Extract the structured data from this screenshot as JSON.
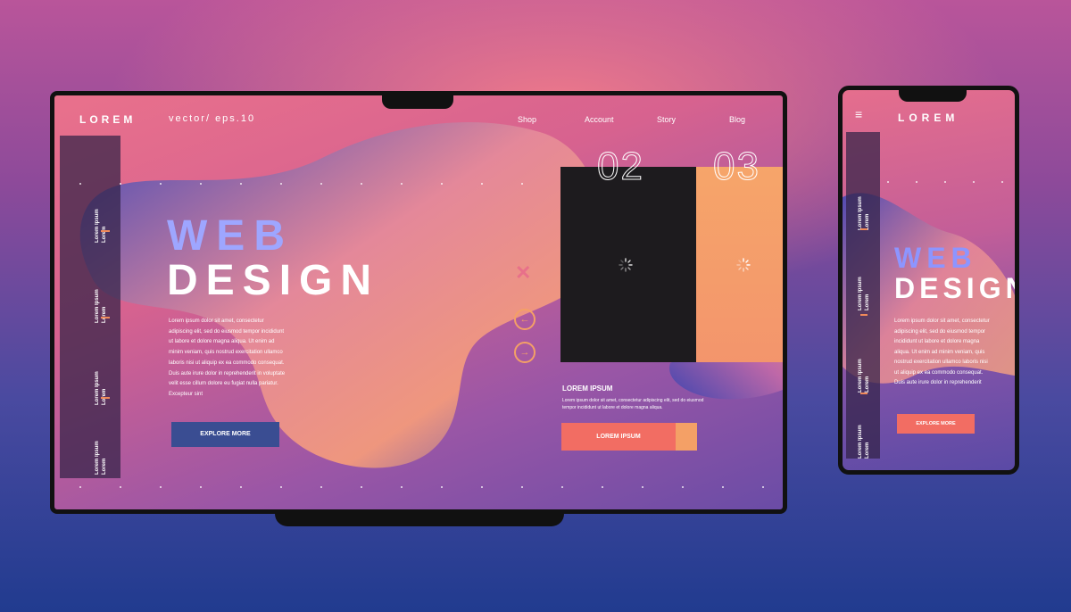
{
  "colors": {
    "accent_coral": "#f26d63",
    "accent_peach": "#f4a066",
    "accent_blue": "#3a4d92",
    "heading_lavender": "#9ea6ff",
    "card_dark": "#1d1b1e"
  },
  "desktop": {
    "nav": {
      "logo": "LOREM",
      "subtitle": "vector/ eps.10",
      "links": [
        "Shop",
        "Account",
        "Story",
        "Blog"
      ]
    },
    "sidebar": {
      "items": [
        "Lorem Ipsum\nLorem",
        "Lorem Ipsum\nLorem",
        "Lorem Ipsum\nLorem",
        "Lorem Ipsum\nLorem"
      ]
    },
    "hero": {
      "line1": "WEB",
      "line2": "DESIGN",
      "body": "Lorem ipsum dolor sit amet, consectetur adipiscing elit, sed do eiusmod tempor incididunt ut labore et dolore magna aliqua. Ut enim ad minim veniam, quis nostrud exercitation ullamco laboris nisi ut aliquip ex ea commodo consequat. Duis aute irure dolor in reprehenderit in voluptate velit esse cillum dolore eu fugiat nulla pariatur. Excepteur sint",
      "button": "EXPLORE MORE"
    },
    "slides": {
      "number_current": "02",
      "number_next": "03",
      "close_icon": "close-icon",
      "prev_icon": "arrow-left-icon",
      "next_icon": "arrow-right-icon",
      "title": "LOREM IPSUM",
      "body": "Lorem ipsum dolor sit amet, consectetur adipiscing elit, sed do eiusmod tempor incididunt ut labore et dolore magna aliqua.",
      "button": "LOREM IPSUM"
    }
  },
  "mobile": {
    "menu_icon": "hamburger-menu-icon",
    "logo": "LOREM",
    "sidebar": {
      "items": [
        "Lorem Ipsum\nLorem",
        "Lorem Ipsum\nLorem",
        "Lorem Ipsum\nLorem",
        "Lorem Ipsum\nLorem"
      ]
    },
    "hero": {
      "line1": "WEB",
      "line2": "DESIGN",
      "body": "Lorem ipsum dolor sit amet, consectetur adipiscing elit, sed do eiusmod tempor incididunt ut labore et dolore magna aliqua. Ut enim ad minim veniam, quis nostrud exercitation ullamco laboris nisi ut aliquip ex ea commodo consequat. Duis aute irure dolor in reprehenderit",
      "button": "EXPLORE MORE"
    }
  }
}
